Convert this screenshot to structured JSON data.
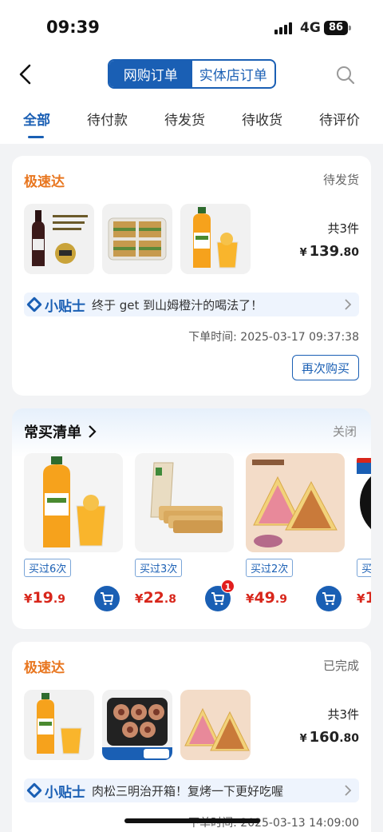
{
  "status_bar": {
    "time": "09:39",
    "network": "4G",
    "battery": "86"
  },
  "header": {
    "segments": [
      {
        "label": "网购订单",
        "active": true
      },
      {
        "label": "实体店订单",
        "active": false
      }
    ],
    "tabs": [
      "全部",
      "待付款",
      "待发货",
      "待收货",
      "待评价"
    ],
    "active_tab": "全部"
  },
  "orders": [
    {
      "store": "极速达",
      "status": "待发货",
      "count_label": "共3件",
      "price_yen": "¥",
      "price_int": "139",
      "price_dec": ".80",
      "tip_badge": "小贴士",
      "tip_text": "终于 get 到山姆橙汁的喝法了！",
      "order_time": "下单时间: 2025-03-17 09:37:38",
      "action": "再次购买",
      "items": [
        "wine-bottle",
        "sandwich-box",
        "orange-juice"
      ]
    },
    {
      "store": "极速达",
      "status": "已完成",
      "count_label": "共3件",
      "price_yen": "¥",
      "price_int": "160",
      "price_dec": ".80",
      "tip_badge": "小贴士",
      "tip_text": "肉松三明治开箱！复烤一下更好吃喔",
      "order_time": "下单时间: 2025-03-13 14:09:00",
      "items": [
        "orange-juice",
        "pork-rolls",
        "sandwich-slice"
      ]
    }
  ],
  "frequent_list": {
    "title": "常买清单",
    "close_label": "关闭",
    "products": [
      {
        "bought": "买过6次",
        "yen": "¥",
        "price_int": "19",
        "price_dec": ".9",
        "badge": ""
      },
      {
        "bought": "买过3次",
        "yen": "¥",
        "price_int": "22",
        "price_dec": ".8",
        "badge": "1"
      },
      {
        "bought": "买过2次",
        "yen": "¥",
        "price_int": "49",
        "price_dec": ".9",
        "badge": ""
      },
      {
        "bought": "买",
        "yen": "¥",
        "price_int": "1",
        "price_dec": "",
        "badge": ""
      }
    ]
  },
  "colors": {
    "brand_blue": "#1a5fb4",
    "store_orange": "#e8761f",
    "price_red": "#d8261b"
  }
}
